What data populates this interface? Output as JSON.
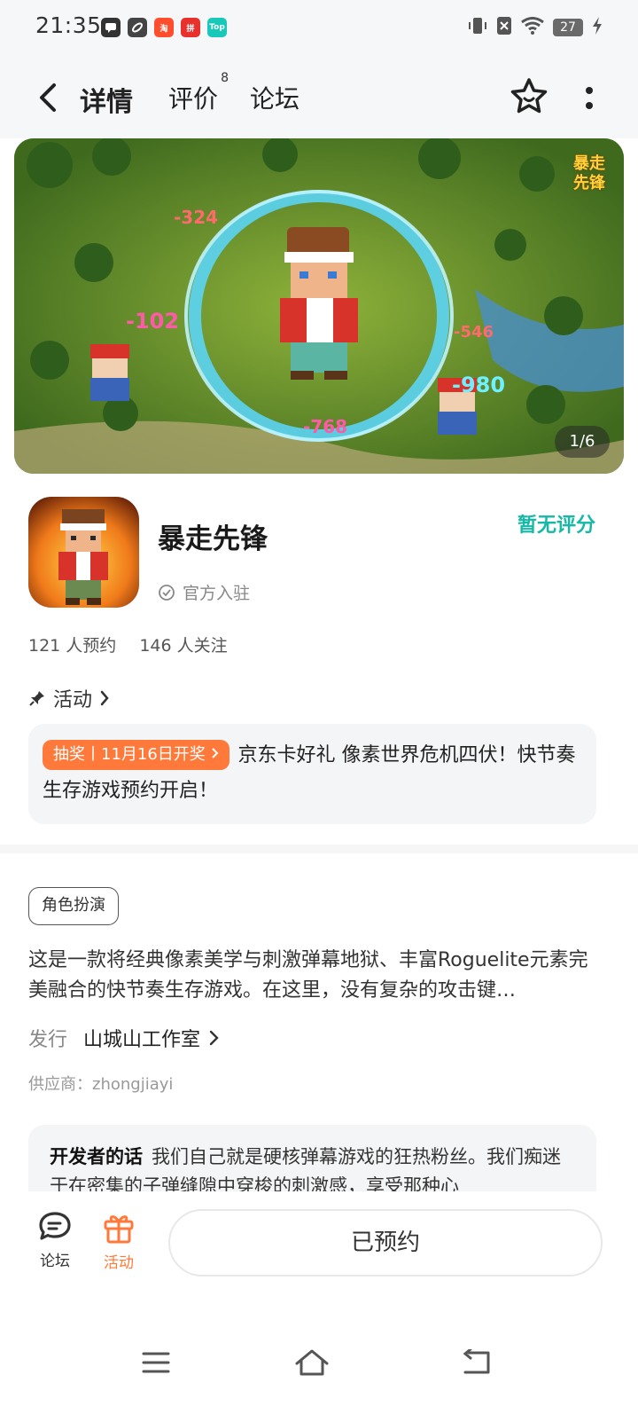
{
  "status_bar": {
    "time": "21:35",
    "battery": "27",
    "app_icons": [
      "message-icon",
      "link-icon",
      "taobao-icon",
      "store-icon",
      "top-app-icon"
    ],
    "top_label": "Top"
  },
  "nav": {
    "tabs": [
      {
        "label": "详情",
        "active": true
      },
      {
        "label": "评价",
        "badge": "8"
      },
      {
        "label": "论坛"
      }
    ]
  },
  "banner": {
    "counter": "1/6",
    "logo_text": "暴走先锋",
    "damage_numbers": [
      "-324",
      "-102",
      "-546",
      "-980",
      "-768"
    ]
  },
  "app": {
    "name": "暴走先锋",
    "score": "暂无评分",
    "official": "官方入驻",
    "reservations": "121 人预约",
    "followers": "146 人关注"
  },
  "activity": {
    "heading": "活动",
    "tag": "抽奖丨11月16日开奖",
    "text": "京东卡好礼 像素世界危机四伏！快节奏生存游戏预约开启！"
  },
  "details": {
    "genre": "角色扮演",
    "description": "这是一款将经典像素美学与刺激弹幕地狱、丰富Roguelite元素完美融合的快节奏生存游戏。在这里，没有复杂的攻击键…",
    "publisher_label": "发行",
    "publisher": "山城山工作室",
    "supplier": "供应商：zhongjiayi"
  },
  "developer": {
    "title": "开发者的话",
    "text": "我们自己就是硬核弹幕游戏的狂热粉丝。我们痴迷于在密集的子弹缝隙中穿梭的刺激感，享受那种心"
  },
  "actions": {
    "forum": "论坛",
    "event": "活动",
    "reserve": "已预约"
  },
  "colors": {
    "accent": "#16c6b4",
    "orange": "#ff7a3a"
  }
}
